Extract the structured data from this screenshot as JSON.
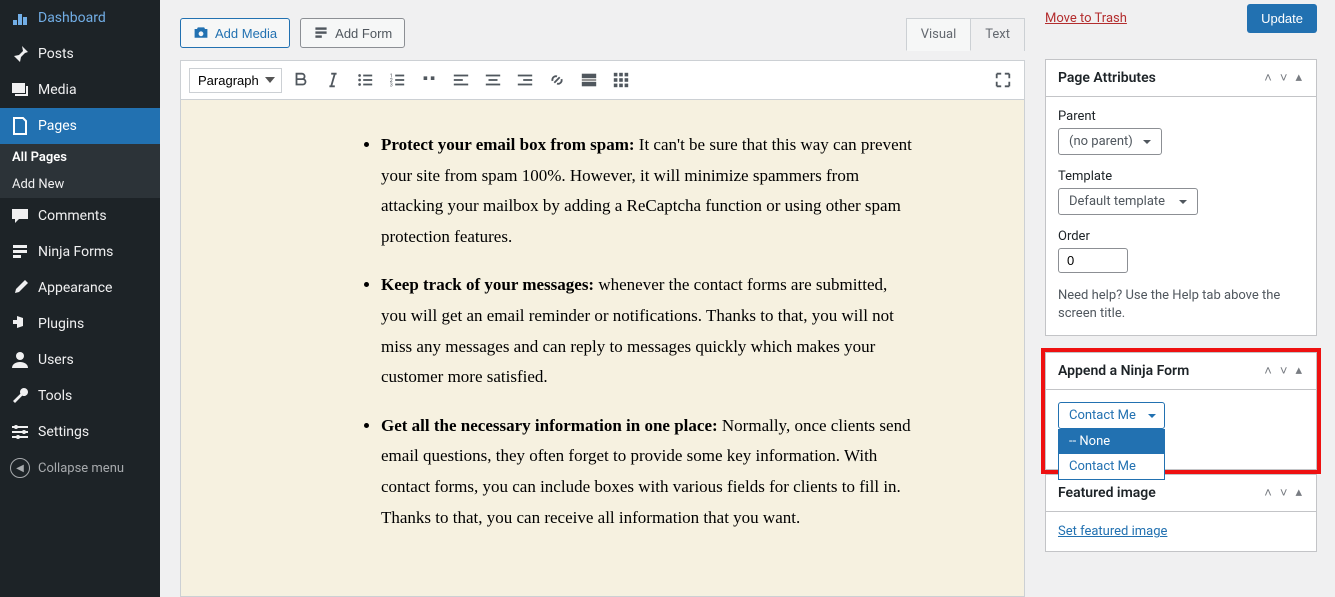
{
  "sidebar": {
    "items": [
      {
        "icon": "dashboard",
        "label": "Dashboard"
      },
      {
        "icon": "pin",
        "label": "Posts"
      },
      {
        "icon": "media",
        "label": "Media"
      },
      {
        "icon": "page",
        "label": "Pages",
        "active": true
      },
      {
        "icon": "comment",
        "label": "Comments"
      },
      {
        "icon": "form",
        "label": "Ninja Forms"
      },
      {
        "icon": "brush",
        "label": "Appearance"
      },
      {
        "icon": "plugin",
        "label": "Plugins"
      },
      {
        "icon": "user",
        "label": "Users"
      },
      {
        "icon": "wrench",
        "label": "Tools"
      },
      {
        "icon": "settings",
        "label": "Settings"
      }
    ],
    "submenu": [
      {
        "label": "All Pages",
        "current": true
      },
      {
        "label": "Add New"
      }
    ],
    "collapse": "Collapse menu"
  },
  "editor": {
    "addMedia": "Add Media",
    "addForm": "Add Form",
    "tabs": {
      "visual": "Visual",
      "text": "Text"
    },
    "formatSelect": "Paragraph",
    "content": {
      "items": [
        {
          "bold": "Protect your email box from spam:",
          "text": " It can't be sure that this way can prevent your site from spam 100%. However, it will minimize spammers from attacking your mailbox by adding a ReCaptcha function or using other spam protection features."
        },
        {
          "bold": "Keep track of your messages:",
          "text": " whenever the contact forms are submitted, you will get an email reminder or notifications. Thanks to that, you will not miss any messages and can reply to messages quickly which makes your customer more satisfied."
        },
        {
          "bold": "Get all the necessary information in one place:",
          "text": " Normally, once clients send email questions, they often forget to provide some key information. With contact forms, you can include boxes with various fields for clients to fill in. Thanks to that, you can receive all information that you want."
        }
      ]
    }
  },
  "publish": {
    "trash": "Move to Trash",
    "update": "Update"
  },
  "pageAttributes": {
    "title": "Page Attributes",
    "parentLabel": "Parent",
    "parentValue": "(no parent)",
    "templateLabel": "Template",
    "templateValue": "Default template",
    "orderLabel": "Order",
    "orderValue": "0",
    "helpText": "Need help? Use the Help tab above the screen title."
  },
  "ninjaForm": {
    "title": "Append a Ninja Form",
    "selected": "Contact Me",
    "options": [
      {
        "label": "-- None",
        "selected": true
      },
      {
        "label": "Contact Me"
      }
    ]
  },
  "featuredImage": {
    "title": "Featured image",
    "setLink": "Set featured image"
  }
}
